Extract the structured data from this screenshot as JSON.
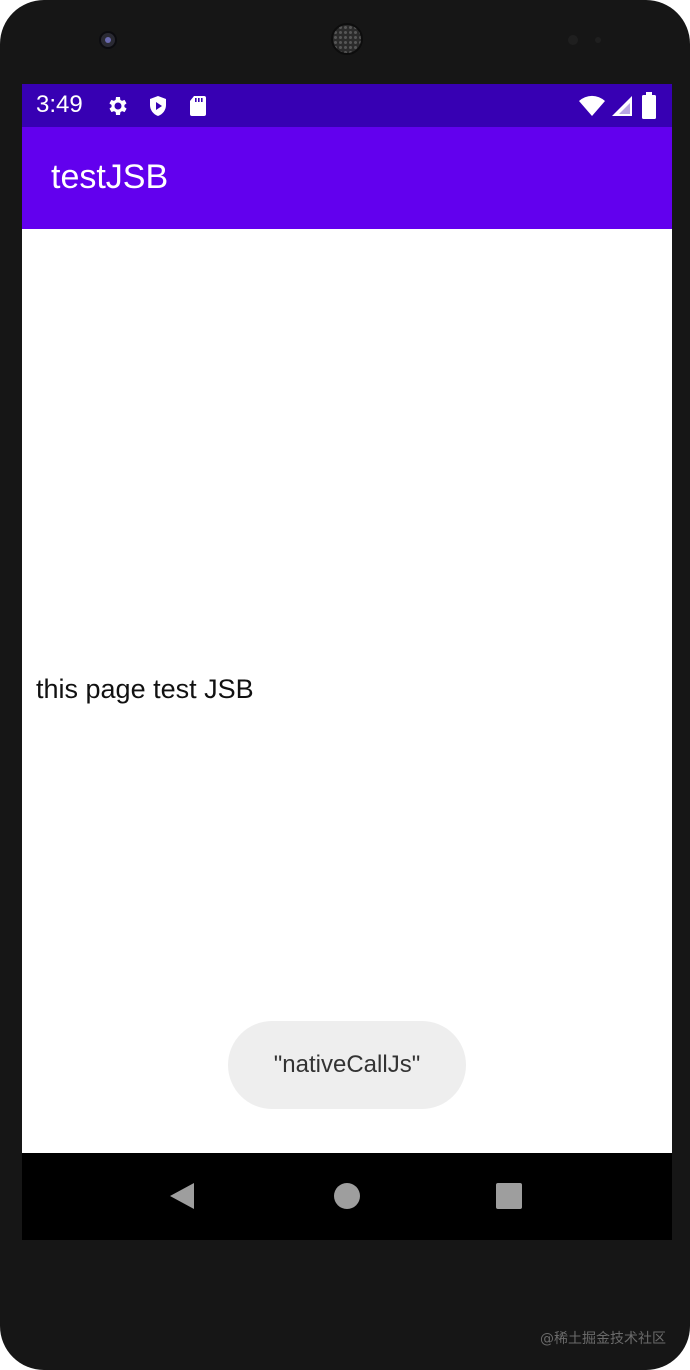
{
  "status_bar": {
    "time": "3:49",
    "icons_left": [
      "gear-icon",
      "shield-play-icon",
      "sd-card-icon"
    ],
    "icons_right": [
      "wifi-icon",
      "signal-icon",
      "battery-icon"
    ],
    "color": "#3700b3"
  },
  "app_bar": {
    "title": "testJSB",
    "color": "#6200ee"
  },
  "content": {
    "text": "this page test JSB"
  },
  "toast": {
    "message": "\"nativeCallJs\""
  },
  "nav_bar": {
    "buttons": [
      "back-triangle-icon",
      "home-circle-icon",
      "recents-square-icon"
    ]
  },
  "watermark": {
    "text": "@稀土掘金技术社区"
  }
}
